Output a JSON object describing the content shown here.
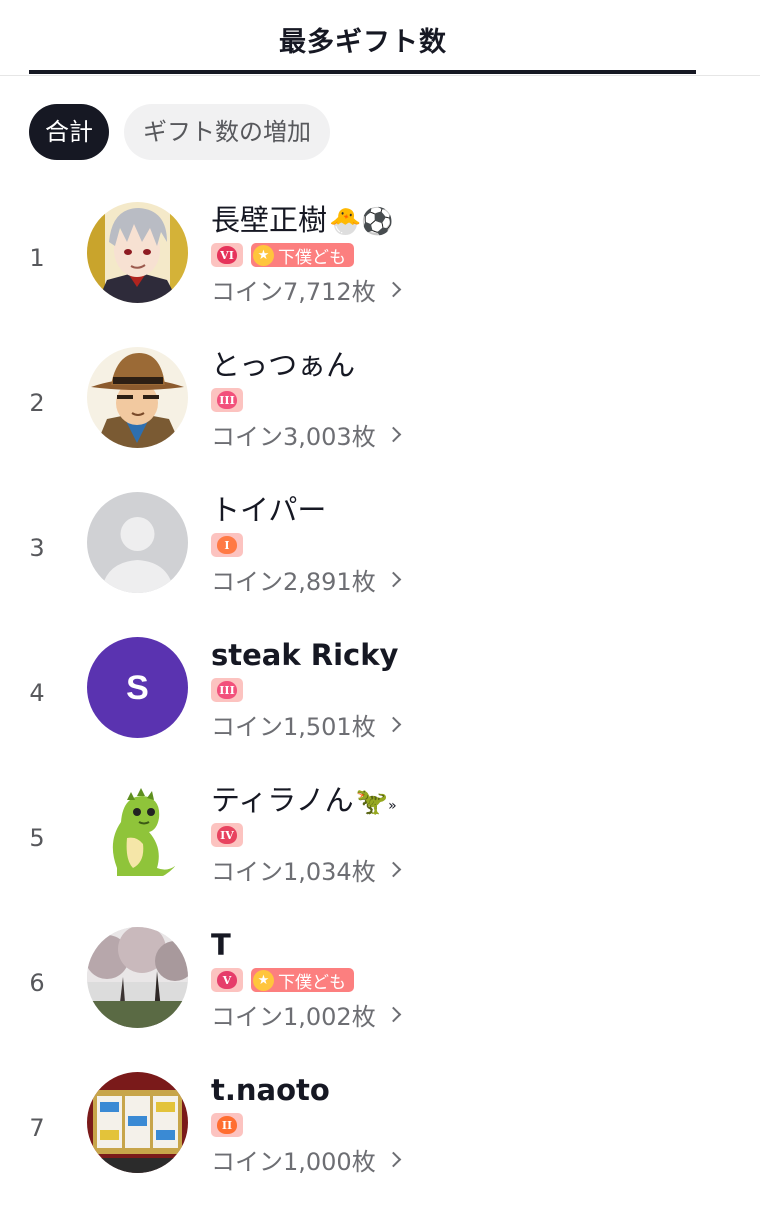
{
  "header": {
    "title": "最多ギフト数"
  },
  "filters": {
    "total": "合計",
    "increase": "ギフト数の増加"
  },
  "colors": {
    "level_heart_1": "#ff7a45",
    "level_heart_2": "#ff6e30",
    "level_heart_3": "#f2507b",
    "level_heart_4": "#e8435f",
    "level_heart_5": "#e63d6a",
    "level_heart_6": "#e6335a",
    "fan_badge": "#fc7f7f"
  },
  "rows": [
    {
      "rank": "1",
      "name": "長壁正樹",
      "name_emoji": "🐣⚽",
      "level": "VI",
      "fan_label": "下僕ども",
      "coins": "コイン7,712枚",
      "avatar_icon": "anime-character-avatar"
    },
    {
      "rank": "2",
      "name": "とっつぁん",
      "name_emoji": "",
      "level": "III",
      "fan_label": "",
      "coins": "コイン3,003枚",
      "avatar_icon": "detective-character-avatar"
    },
    {
      "rank": "3",
      "name": "トイパー",
      "name_emoji": "",
      "level": "I",
      "fan_label": "",
      "coins": "コイン2,891枚",
      "avatar_icon": "default-person-avatar"
    },
    {
      "rank": "4",
      "name": "steak Ricky",
      "name_emoji": "",
      "level": "III",
      "fan_label": "",
      "coins": "コイン1,501枚",
      "avatar_icon": "letter-avatar",
      "avatar_letter": "S"
    },
    {
      "rank": "5",
      "name": "ティラノん",
      "name_emoji": "🦖",
      "name_suffix": "»",
      "level": "IV",
      "fan_label": "",
      "coins": "コイン1,034枚",
      "avatar_icon": "dinosaur-avatar"
    },
    {
      "rank": "6",
      "name": "T",
      "name_emoji": "",
      "level": "V",
      "fan_label": "下僕ども",
      "coins": "コイン1,002枚",
      "avatar_icon": "cherry-blossom-photo-avatar"
    },
    {
      "rank": "7",
      "name": "t.naoto",
      "name_emoji": "",
      "level": "II",
      "fan_label": "",
      "coins": "コイン1,000枚",
      "avatar_icon": "slot-machine-avatar"
    }
  ]
}
